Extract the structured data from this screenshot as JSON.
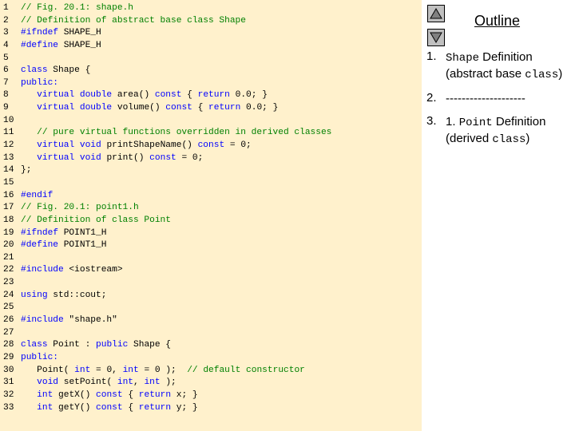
{
  "code": {
    "lines": [
      {
        "num": "1",
        "parts": [
          {
            "t": "// Fig. 20.1: shape.h",
            "c": "comment"
          }
        ]
      },
      {
        "num": "2",
        "parts": [
          {
            "t": "// Definition of abstract base class Shape",
            "c": "comment"
          }
        ]
      },
      {
        "num": "3",
        "parts": [
          {
            "t": "#ifndef",
            "c": "kw"
          },
          {
            "t": " SHAPE_H",
            "c": "text"
          }
        ]
      },
      {
        "num": "4",
        "parts": [
          {
            "t": "#define",
            "c": "kw"
          },
          {
            "t": " SHAPE_H",
            "c": "text"
          }
        ]
      },
      {
        "num": "5",
        "parts": []
      },
      {
        "num": "6",
        "parts": [
          {
            "t": "class",
            "c": "kw"
          },
          {
            "t": " Shape {",
            "c": "text"
          }
        ]
      },
      {
        "num": "7",
        "parts": [
          {
            "t": "public:",
            "c": "kw"
          }
        ]
      },
      {
        "num": "8",
        "parts": [
          {
            "t": "   ",
            "c": "text"
          },
          {
            "t": "virtual double",
            "c": "kw"
          },
          {
            "t": " area() ",
            "c": "text"
          },
          {
            "t": "const",
            "c": "kw"
          },
          {
            "t": " { ",
            "c": "text"
          },
          {
            "t": "return",
            "c": "kw"
          },
          {
            "t": " 0.0; }",
            "c": "text"
          }
        ]
      },
      {
        "num": "9",
        "parts": [
          {
            "t": "   ",
            "c": "text"
          },
          {
            "t": "virtual double",
            "c": "kw"
          },
          {
            "t": " volume() ",
            "c": "text"
          },
          {
            "t": "const",
            "c": "kw"
          },
          {
            "t": " { ",
            "c": "text"
          },
          {
            "t": "return",
            "c": "kw"
          },
          {
            "t": " 0.0; }",
            "c": "text"
          }
        ]
      },
      {
        "num": "10",
        "parts": []
      },
      {
        "num": "11",
        "parts": [
          {
            "t": "   // pure virtual functions overridden in derived classes",
            "c": "comment"
          }
        ]
      },
      {
        "num": "12",
        "parts": [
          {
            "t": "   ",
            "c": "text"
          },
          {
            "t": "virtual void",
            "c": "kw"
          },
          {
            "t": " printShapeName() ",
            "c": "text"
          },
          {
            "t": "const",
            "c": "kw"
          },
          {
            "t": " = 0;",
            "c": "text"
          }
        ]
      },
      {
        "num": "13",
        "parts": [
          {
            "t": "   ",
            "c": "text"
          },
          {
            "t": "virtual void",
            "c": "kw"
          },
          {
            "t": " print() ",
            "c": "text"
          },
          {
            "t": "const",
            "c": "kw"
          },
          {
            "t": " = 0;",
            "c": "text"
          }
        ]
      },
      {
        "num": "14",
        "parts": [
          {
            "t": "};",
            "c": "text"
          }
        ]
      },
      {
        "num": "15",
        "parts": []
      },
      {
        "num": "16",
        "parts": [
          {
            "t": "#endif",
            "c": "kw"
          }
        ]
      },
      {
        "num": "17",
        "parts": [
          {
            "t": "// Fig. 20.1: point1.h",
            "c": "comment"
          }
        ]
      },
      {
        "num": "18",
        "parts": [
          {
            "t": "// Definition of class Point",
            "c": "comment"
          }
        ]
      },
      {
        "num": "19",
        "parts": [
          {
            "t": "#ifndef",
            "c": "kw"
          },
          {
            "t": " POINT1_H",
            "c": "text"
          }
        ]
      },
      {
        "num": "20",
        "parts": [
          {
            "t": "#define",
            "c": "kw"
          },
          {
            "t": " POINT1_H",
            "c": "text"
          }
        ]
      },
      {
        "num": "21",
        "parts": []
      },
      {
        "num": "22",
        "parts": [
          {
            "t": "#include",
            "c": "kw"
          },
          {
            "t": " <iostream>",
            "c": "text"
          }
        ]
      },
      {
        "num": "23",
        "parts": []
      },
      {
        "num": "24",
        "parts": [
          {
            "t": "using",
            "c": "kw"
          },
          {
            "t": " std::cout;",
            "c": "text"
          }
        ]
      },
      {
        "num": "25",
        "parts": []
      },
      {
        "num": "26",
        "parts": [
          {
            "t": "#include",
            "c": "kw"
          },
          {
            "t": " \"shape.h\"",
            "c": "text"
          }
        ]
      },
      {
        "num": "27",
        "parts": []
      },
      {
        "num": "28",
        "parts": [
          {
            "t": "class",
            "c": "kw"
          },
          {
            "t": " Point : ",
            "c": "text"
          },
          {
            "t": "public",
            "c": "kw"
          },
          {
            "t": " Shape {",
            "c": "text"
          }
        ]
      },
      {
        "num": "29",
        "parts": [
          {
            "t": "public:",
            "c": "kw"
          }
        ]
      },
      {
        "num": "30",
        "parts": [
          {
            "t": "   Point( ",
            "c": "text"
          },
          {
            "t": "int",
            "c": "kw"
          },
          {
            "t": " = 0, ",
            "c": "text"
          },
          {
            "t": "int",
            "c": "kw"
          },
          {
            "t": " = 0 );  ",
            "c": "text"
          },
          {
            "t": "// default constructor",
            "c": "comment"
          }
        ]
      },
      {
        "num": "31",
        "parts": [
          {
            "t": "   ",
            "c": "text"
          },
          {
            "t": "void",
            "c": "kw"
          },
          {
            "t": " setPoint( ",
            "c": "text"
          },
          {
            "t": "int",
            "c": "kw"
          },
          {
            "t": ", ",
            "c": "text"
          },
          {
            "t": "int",
            "c": "kw"
          },
          {
            "t": " );",
            "c": "text"
          }
        ]
      },
      {
        "num": "32",
        "parts": [
          {
            "t": "   ",
            "c": "text"
          },
          {
            "t": "int",
            "c": "kw"
          },
          {
            "t": " getX() ",
            "c": "text"
          },
          {
            "t": "const",
            "c": "kw"
          },
          {
            "t": " { ",
            "c": "text"
          },
          {
            "t": "return",
            "c": "kw"
          },
          {
            "t": " x; }",
            "c": "text"
          }
        ]
      },
      {
        "num": "33",
        "parts": [
          {
            "t": "   ",
            "c": "text"
          },
          {
            "t": "int",
            "c": "kw"
          },
          {
            "t": " getY() ",
            "c": "text"
          },
          {
            "t": "const",
            "c": "kw"
          },
          {
            "t": " { ",
            "c": "text"
          },
          {
            "t": "return",
            "c": "kw"
          },
          {
            "t": " y; }",
            "c": "text"
          }
        ]
      }
    ]
  },
  "colors": {
    "code_background": "#fff1cc",
    "comment": "#008000",
    "keyword": "#0000ff",
    "text": "#000000"
  },
  "outline": {
    "title": "Outline",
    "up_icon": "triangle-up-icon",
    "down_icon": "triangle-down-icon",
    "items": [
      {
        "number": "1.",
        "code1": "Shape",
        "text1": " Definition (abstract base ",
        "code2": "class",
        "text2": ")"
      },
      {
        "number": "2.",
        "code1": "",
        "text1": "--------------------",
        "code2": "",
        "text2": ""
      },
      {
        "number": "3.",
        "code1": "",
        "text1": "1. ",
        "code2": "Point",
        "text2": " Definition (derived ",
        "code3": "class",
        "text3": ")"
      }
    ]
  }
}
